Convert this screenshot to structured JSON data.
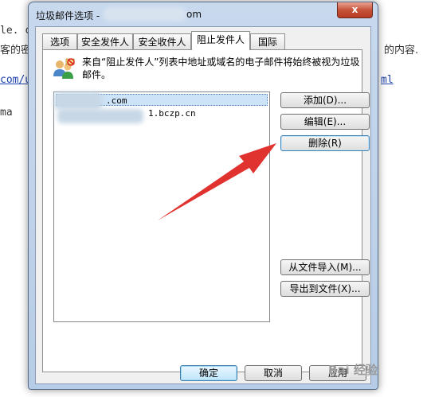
{
  "background": {
    "line1": "le. c",
    "line2": "客的密",
    "line2_right": "的内容.",
    "link_left": "com/u",
    "link_right": "ml",
    "line4": "ma"
  },
  "window": {
    "title": "垃圾邮件选项 -",
    "title_tail": "om",
    "close_glyph": "x"
  },
  "tabs": [
    {
      "label": "选项"
    },
    {
      "label": "安全发件人"
    },
    {
      "label": "安全收件人"
    },
    {
      "label": "阻止发件人"
    },
    {
      "label": "国际"
    }
  ],
  "description": "来自“阻止发件人”列表中地址或域名的电子邮件将始终被视为垃圾邮件。",
  "list": {
    "items": [
      {
        "text": ".com"
      },
      {
        "text": "1.bczp.cn"
      }
    ]
  },
  "buttons": {
    "add": "添加(D)...",
    "edit": "编辑(E)...",
    "delete": "删除(R)",
    "import": "从文件导入(M)...",
    "export": "导出到文件(X)..."
  },
  "footer": {
    "ok": "确定",
    "cancel": "取消",
    "apply": "应用"
  },
  "watermark": "Bai 经验",
  "annotation_color": "#e0322f"
}
